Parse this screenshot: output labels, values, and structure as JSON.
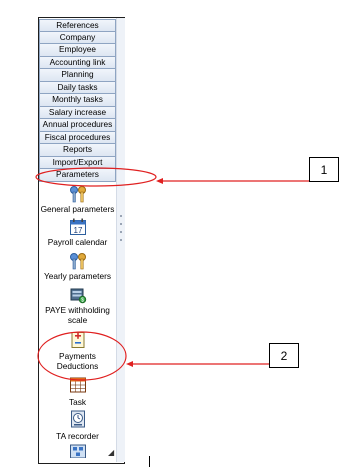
{
  "menu": {
    "items": [
      "References",
      "Company",
      "Employee",
      "Accounting link",
      "Planning",
      "Daily tasks",
      "Monthly tasks",
      "Salary increase",
      "Annual procedures",
      "Fiscal procedures",
      "Reports",
      "Import/Export",
      "Parameters"
    ]
  },
  "tools": {
    "general_parameters": "General parameters",
    "payroll_calendar": "Payroll calendar",
    "yearly_parameters": "Yearly parameters",
    "paye_line1": "PAYE withholding",
    "paye_line2": "scale",
    "payments_line1": "Payments",
    "payments_line2": "Deductions",
    "task": "Task",
    "ta_recorder": "TA recorder"
  },
  "calendar_icon_day": "17",
  "callouts": {
    "one": "1",
    "two": "2"
  },
  "colors": {
    "annotation_red": "#e02020",
    "menu_border": "#8ea4c2"
  }
}
